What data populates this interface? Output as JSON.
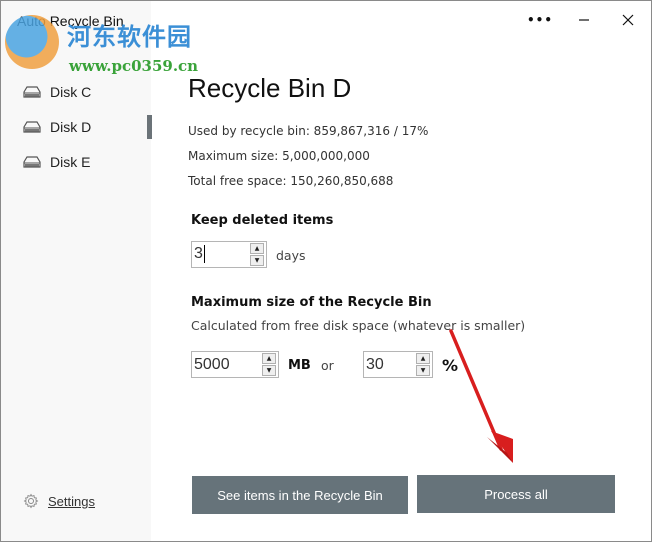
{
  "window": {
    "title": "Auto Recycle Bin",
    "more_icon": "more-horizontal-icon",
    "minimize_icon": "minimize-icon",
    "close_icon": "close-icon"
  },
  "watermark": {
    "chinese_text": "河东软件园",
    "url": "www.pc0359.cn"
  },
  "sidebar": {
    "items": [
      {
        "label": "Disk C",
        "icon": "drive-icon",
        "selected": false
      },
      {
        "label": "Disk D",
        "icon": "drive-icon",
        "selected": true
      },
      {
        "label": "Disk E",
        "icon": "drive-icon",
        "selected": false
      }
    ],
    "settings_label": "Settings",
    "settings_icon": "gear-icon"
  },
  "main": {
    "title": "Recycle Bin D",
    "info": [
      "Used by recycle bin: 859,867,316 / 17%",
      "Maximum size: 5,000,000,000",
      "Total free space: 150,260,850,688"
    ],
    "keep": {
      "heading": "Keep deleted items",
      "value": "3",
      "unit": "days"
    },
    "max_size": {
      "heading": "Maximum size of the Recycle Bin",
      "description": "Calculated from free disk space (whatever is smaller)",
      "mb_value": "5000",
      "mb_unit": "MB",
      "or_label": "or",
      "percent_value": "30",
      "percent_unit": "%"
    },
    "buttons": {
      "see_items": "See items in the Recycle Bin",
      "process_all": "Process all"
    }
  },
  "colors": {
    "button_bg": "#66737a",
    "sidebar_bg": "#f8f8f8",
    "selection_indicator": "#6b7378",
    "annotation_arrow": "#d81e1e"
  }
}
